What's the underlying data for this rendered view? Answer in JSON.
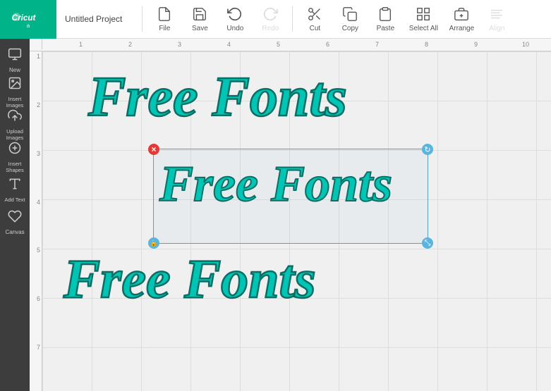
{
  "toolbar": {
    "logo_text": "Cricut",
    "project_title": "Untitled Project",
    "buttons": [
      {
        "id": "file",
        "label": "File",
        "has_arrow": true,
        "disabled": false
      },
      {
        "id": "save",
        "label": "Save",
        "has_arrow": false,
        "disabled": false
      },
      {
        "id": "undo",
        "label": "Undo",
        "has_arrow": false,
        "disabled": false
      },
      {
        "id": "redo",
        "label": "Redo",
        "has_arrow": false,
        "disabled": true
      },
      {
        "id": "cut",
        "label": "Cut",
        "has_arrow": false,
        "disabled": false
      },
      {
        "id": "copy",
        "label": "Copy",
        "has_arrow": false,
        "disabled": false
      },
      {
        "id": "paste",
        "label": "Paste",
        "has_arrow": false,
        "disabled": false
      },
      {
        "id": "select-all",
        "label": "Select All",
        "has_arrow": false,
        "disabled": false
      },
      {
        "id": "arrange",
        "label": "Arrange",
        "has_arrow": true,
        "disabled": false
      },
      {
        "id": "align",
        "label": "Align",
        "has_arrow": false,
        "disabled": true
      }
    ]
  },
  "sidebar": {
    "items": [
      {
        "id": "new",
        "label": "New",
        "icon": "new"
      },
      {
        "id": "insert-images",
        "label": "Insert Images",
        "icon": "images"
      },
      {
        "id": "upload-images",
        "label": "Upload Images",
        "icon": "upload"
      },
      {
        "id": "insert-shapes",
        "label": "Insert Shapes",
        "icon": "shapes"
      },
      {
        "id": "add-text",
        "label": "Add Text",
        "icon": "text"
      },
      {
        "id": "canvas",
        "label": "Canvas",
        "icon": "canvas"
      }
    ]
  },
  "canvas": {
    "texts": [
      {
        "id": "text-top",
        "content": "Free Fonts",
        "size": "large",
        "selected": false
      },
      {
        "id": "text-middle",
        "content": "Free Fonts",
        "size": "medium",
        "selected": true
      },
      {
        "id": "text-bottom",
        "content": "Free Fonts",
        "size": "large",
        "selected": false
      }
    ],
    "ruler": {
      "h_marks": [
        "1",
        "2",
        "3",
        "4",
        "5",
        "6",
        "7",
        "8",
        "9",
        "10"
      ],
      "v_marks": [
        "1",
        "2",
        "3",
        "4",
        "5",
        "6",
        "7"
      ]
    }
  },
  "selection": {
    "close_symbol": "×",
    "rotate_symbol": "↻",
    "lock_symbol": "🔒",
    "scale_symbol": "⤡"
  },
  "user": {
    "initial": "a"
  },
  "colors": {
    "teal_primary": "#00c5b5",
    "teal_stroke": "#0a6e64",
    "toolbar_bg": "#ffffff",
    "sidebar_bg": "#3d3d3d",
    "canvas_bg": "#d0d0d0",
    "grid_line": "#dddddd",
    "selection_border": "#5a9bd4",
    "logo_green": "#00b388",
    "handle_red": "#e53935",
    "handle_blue": "#5ab4e0"
  }
}
